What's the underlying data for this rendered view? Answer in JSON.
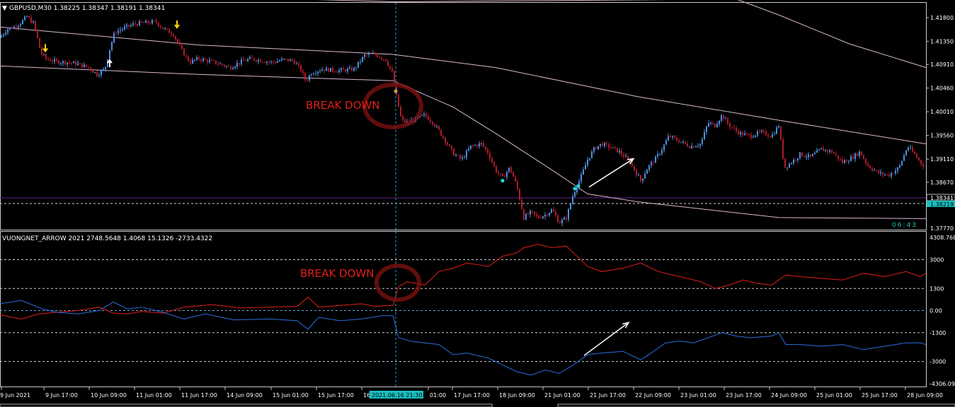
{
  "main_header": "GBPUSD,M30  1.38225 1.38347 1.38191 1.38341",
  "indicator_header": "VUONGNET_ARROW 2021 2748.5648 1.4068 15.1326 -2733.4322",
  "annotations": {
    "main_break": "BREAK DOWN",
    "ind_break": "BREAK DOWN"
  },
  "countdown": "06:43",
  "colors": {
    "background": "#000000",
    "bull": "#4f8fe0",
    "bear": "#b01c2a",
    "band": "#d9b7d3",
    "cursor": "#2aa6e0",
    "red_line": "#e0201c",
    "blue_line": "#2a6fe0",
    "annotation": "#e0201c",
    "arrow_down": "#ffd700",
    "arrow_up": "#ffffff",
    "dot_cyan": "#17e0e0"
  },
  "chart_data": [
    {
      "type": "candlestick",
      "symbol": "GBPUSD",
      "timeframe": "M30",
      "ylim": [
        1.3777,
        1.4208
      ],
      "y_ticks": [
        "1.41800",
        "1.41350",
        "1.40910",
        "1.40460",
        "1.40010",
        "1.39560",
        "1.39110",
        "1.38670"
      ],
      "last_price": "1.38341",
      "bid_line": "1.38219",
      "bottom_label": "1.37770",
      "close_path": [
        [
          0,
          1.4142
        ],
        [
          10,
          1.4158
        ],
        [
          20,
          1.4162
        ],
        [
          30,
          1.4171
        ],
        [
          38,
          1.4182
        ],
        [
          48,
          1.4168
        ],
        [
          58,
          1.4112
        ],
        [
          66,
          1.4101
        ],
        [
          80,
          1.4096
        ],
        [
          95,
          1.4095
        ],
        [
          110,
          1.4092
        ],
        [
          125,
          1.4085
        ],
        [
          137,
          1.4072
        ],
        [
          148,
          1.4082
        ],
        [
          155,
          1.412
        ],
        [
          162,
          1.4152
        ],
        [
          175,
          1.416
        ],
        [
          190,
          1.4168
        ],
        [
          205,
          1.417
        ],
        [
          220,
          1.4172
        ],
        [
          232,
          1.4158
        ],
        [
          245,
          1.4148
        ],
        [
          258,
          1.4115
        ],
        [
          268,
          1.4095
        ],
        [
          280,
          1.4102
        ],
        [
          295,
          1.4098
        ],
        [
          310,
          1.4092
        ],
        [
          325,
          1.4085
        ],
        [
          340,
          1.4096
        ],
        [
          355,
          1.4102
        ],
        [
          370,
          1.4098
        ],
        [
          385,
          1.4095
        ],
        [
          400,
          1.41
        ],
        [
          415,
          1.4098
        ],
        [
          425,
          1.408
        ],
        [
          432,
          1.406
        ],
        [
          440,
          1.4075
        ],
        [
          455,
          1.4082
        ],
        [
          470,
          1.408
        ],
        [
          485,
          1.408
        ],
        [
          500,
          1.4082
        ],
        [
          515,
          1.4108
        ],
        [
          530,
          1.411
        ],
        [
          545,
          1.41
        ],
        [
          555,
          1.4072
        ],
        [
          560,
          1.403
        ],
        [
          567,
          1.3985
        ],
        [
          575,
          1.398
        ],
        [
          585,
          1.3985
        ],
        [
          600,
          1.3995
        ],
        [
          612,
          1.398
        ],
        [
          625,
          1.3955
        ],
        [
          640,
          1.3922
        ],
        [
          652,
          1.391
        ],
        [
          665,
          1.3935
        ],
        [
          680,
          1.394
        ],
        [
          690,
          1.3922
        ],
        [
          700,
          1.389
        ],
        [
          710,
          1.3875
        ],
        [
          720,
          1.3895
        ],
        [
          730,
          1.386
        ],
        [
          740,
          1.38
        ],
        [
          750,
          1.381
        ],
        [
          760,
          1.38
        ],
        [
          770,
          1.3805
        ],
        [
          780,
          1.3815
        ],
        [
          790,
          1.379
        ],
        [
          800,
          1.38
        ],
        [
          810,
          1.3845
        ],
        [
          820,
          1.3875
        ],
        [
          830,
          1.391
        ],
        [
          840,
          1.3932
        ],
        [
          850,
          1.394
        ],
        [
          860,
          1.3935
        ],
        [
          875,
          1.3925
        ],
        [
          890,
          1.3905
        ],
        [
          905,
          1.387
        ],
        [
          915,
          1.3895
        ],
        [
          925,
          1.391
        ],
        [
          935,
          1.393
        ],
        [
          945,
          1.3955
        ],
        [
          960,
          1.3945
        ],
        [
          975,
          1.3935
        ],
        [
          990,
          1.394
        ],
        [
          1000,
          1.398
        ],
        [
          1010,
          1.3975
        ],
        [
          1020,
          1.3995
        ],
        [
          1030,
          1.3975
        ],
        [
          1045,
          1.396
        ],
        [
          1060,
          1.3955
        ],
        [
          1075,
          1.3962
        ],
        [
          1090,
          1.3955
        ],
        [
          1100,
          1.3975
        ],
        [
          1108,
          1.3895
        ],
        [
          1118,
          1.3905
        ],
        [
          1130,
          1.392
        ],
        [
          1145,
          1.3915
        ],
        [
          1160,
          1.393
        ],
        [
          1175,
          1.3925
        ],
        [
          1190,
          1.3905
        ],
        [
          1205,
          1.3915
        ],
        [
          1215,
          1.3925
        ],
        [
          1225,
          1.39
        ],
        [
          1240,
          1.3885
        ],
        [
          1255,
          1.388
        ],
        [
          1270,
          1.3895
        ],
        [
          1282,
          1.3935
        ],
        [
          1292,
          1.392
        ],
        [
          1300,
          1.3905
        ],
        [
          1308,
          1.3895
        ]
      ],
      "upper_band": [
        [
          0,
          1.4162
        ],
        [
          280,
          1.4128
        ],
        [
          555,
          1.411
        ],
        [
          700,
          1.4085
        ],
        [
          900,
          1.403
        ],
        [
          1100,
          1.3985
        ],
        [
          1308,
          1.394
        ]
      ],
      "middle_band": [
        [
          0,
          1.4088
        ],
        [
          280,
          1.4072
        ],
        [
          555,
          1.406
        ],
        [
          640,
          1.401
        ],
        [
          700,
          1.396
        ],
        [
          780,
          1.389
        ],
        [
          830,
          1.3845
        ],
        [
          900,
          1.383
        ],
        [
          1100,
          1.38
        ],
        [
          1308,
          1.3798
        ]
      ],
      "outer_band": [
        [
          280,
          1.422
        ],
        [
          560,
          1.421
        ],
        [
          1040,
          1.4215
        ],
        [
          1100,
          1.4185
        ],
        [
          1200,
          1.413
        ],
        [
          1308,
          1.4085
        ]
      ],
      "arrows_down": [
        [
          64,
          1.412
        ],
        [
          250,
          1.4165
        ]
      ],
      "arrows_up": [
        [
          155,
          1.4095
        ]
      ],
      "dots_cyan": [
        [
          710,
          1.387
        ],
        [
          812,
          1.3855
        ],
        [
          817,
          1.386
        ]
      ],
      "dot_orange": [
        [
          559,
          1.404
        ]
      ],
      "trend_arrow": [
        [
          832,
          1.3858
        ],
        [
          895,
          1.3912
        ]
      ]
    },
    {
      "type": "line",
      "name_label": "VUONGNET_ARROW",
      "ylim": [
        -4306.09,
        4308.768
      ],
      "y_ticks": [
        "4308.768",
        "3000",
        "1300",
        "0.00",
        "-1300",
        "-3000",
        "-4306.09"
      ],
      "series": [
        {
          "color": "red",
          "points": [
            [
              0,
              -250
            ],
            [
              30,
              -500
            ],
            [
              55,
              -200
            ],
            [
              80,
              -100
            ],
            [
              110,
              0
            ],
            [
              140,
              200
            ],
            [
              160,
              -150
            ],
            [
              180,
              -200
            ],
            [
              200,
              -50
            ],
            [
              230,
              -150
            ],
            [
              260,
              200
            ],
            [
              300,
              350
            ],
            [
              340,
              150
            ],
            [
              380,
              200
            ],
            [
              420,
              250
            ],
            [
              435,
              800
            ],
            [
              450,
              200
            ],
            [
              480,
              300
            ],
            [
              510,
              400
            ],
            [
              530,
              250
            ],
            [
              555,
              300
            ],
            [
              563,
              1400
            ],
            [
              575,
              1700
            ],
            [
              600,
              1500
            ],
            [
              620,
              2300
            ],
            [
              640,
              2500
            ],
            [
              660,
              2800
            ],
            [
              690,
              2600
            ],
            [
              710,
              3200
            ],
            [
              730,
              3400
            ],
            [
              740,
              3700
            ],
            [
              760,
              3900
            ],
            [
              780,
              3700
            ],
            [
              800,
              3800
            ],
            [
              810,
              3400
            ],
            [
              830,
              2600
            ],
            [
              850,
              2300
            ],
            [
              880,
              2500
            ],
            [
              905,
              2800
            ],
            [
              930,
              2300
            ],
            [
              960,
              2000
            ],
            [
              990,
              1700
            ],
            [
              1010,
              1300
            ],
            [
              1030,
              1500
            ],
            [
              1050,
              1800
            ],
            [
              1070,
              1600
            ],
            [
              1090,
              1500
            ],
            [
              1100,
              1800
            ],
            [
              1110,
              2100
            ],
            [
              1130,
              2000
            ],
            [
              1160,
              1900
            ],
            [
              1190,
              1800
            ],
            [
              1220,
              2200
            ],
            [
              1250,
              2000
            ],
            [
              1280,
              2300
            ],
            [
              1300,
              2000
            ],
            [
              1308,
              2200
            ]
          ]
        },
        {
          "color": "blue",
          "points": [
            [
              0,
              400
            ],
            [
              30,
              600
            ],
            [
              60,
              100
            ],
            [
              80,
              -100
            ],
            [
              110,
              -200
            ],
            [
              140,
              0
            ],
            [
              160,
              500
            ],
            [
              180,
              100
            ],
            [
              200,
              200
            ],
            [
              230,
              -100
            ],
            [
              260,
              -500
            ],
            [
              290,
              -200
            ],
            [
              330,
              -550
            ],
            [
              380,
              -500
            ],
            [
              420,
              -600
            ],
            [
              435,
              -1100
            ],
            [
              450,
              -400
            ],
            [
              480,
              -600
            ],
            [
              510,
              -500
            ],
            [
              540,
              -300
            ],
            [
              555,
              -300
            ],
            [
              563,
              -1600
            ],
            [
              580,
              -1800
            ],
            [
              600,
              -1900
            ],
            [
              620,
              -2000
            ],
            [
              640,
              -2600
            ],
            [
              660,
              -2500
            ],
            [
              690,
              -2800
            ],
            [
              710,
              -3200
            ],
            [
              730,
              -3600
            ],
            [
              750,
              -3800
            ],
            [
              770,
              -3500
            ],
            [
              790,
              -3700
            ],
            [
              810,
              -3200
            ],
            [
              830,
              -2600
            ],
            [
              850,
              -2500
            ],
            [
              880,
              -2400
            ],
            [
              905,
              -2900
            ],
            [
              920,
              -2500
            ],
            [
              940,
              -1900
            ],
            [
              960,
              -1800
            ],
            [
              980,
              -1900
            ],
            [
              1000,
              -1600
            ],
            [
              1020,
              -1300
            ],
            [
              1040,
              -1500
            ],
            [
              1060,
              -1600
            ],
            [
              1090,
              -1500
            ],
            [
              1100,
              -1300
            ],
            [
              1110,
              -2000
            ],
            [
              1130,
              -2000
            ],
            [
              1160,
              -2100
            ],
            [
              1190,
              -2000
            ],
            [
              1220,
              -2300
            ],
            [
              1250,
              -2100
            ],
            [
              1280,
              -1900
            ],
            [
              1300,
              -1900
            ],
            [
              1308,
              -2000
            ]
          ]
        }
      ],
      "trend_arrow": [
        [
          825,
          -2650
        ],
        [
          888,
          -700
        ]
      ]
    }
  ],
  "x_labels": [
    "9 Jun 2021",
    "9 Jun 17:00",
    "10 Jun 09:00",
    "11 Jun 01:00",
    "11 Jun 17:00",
    "14 Jun 09:00",
    "15 Jun 01:00",
    "15 Jun 17:00",
    "16",
    "2021.06.16 21:30",
    "01:00",
    "17 Jun 17:00",
    "18 Jun 09:00",
    "21 Jun 01:00",
    "21 Jun 17:00",
    "22 Jun 09:00",
    "23 Jun 01:00",
    "23 Jun 17:00",
    "24 Jun 09:00",
    "25 Jun 01:00",
    "25 Jun 17:00",
    "28 Jun 09:00"
  ]
}
